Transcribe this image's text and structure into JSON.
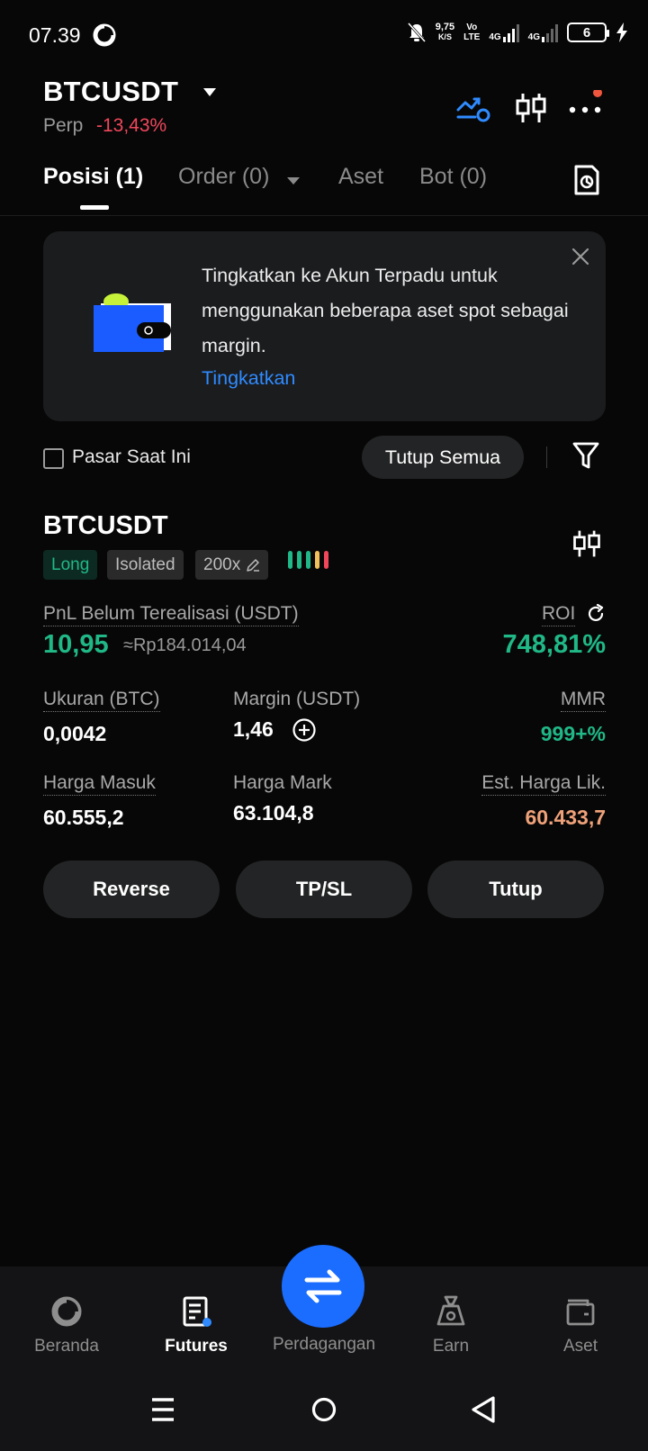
{
  "status_bar": {
    "time": "07.39",
    "speed_value": "9,75",
    "speed_unit": "K/S",
    "volte_top": "Vo",
    "volte_bottom": "LTE",
    "sim1": "4G",
    "sim2": "4G",
    "battery": "6"
  },
  "header": {
    "pair": "BTCUSDT",
    "contract_type": "Perp",
    "change": "-13,43%",
    "icons": [
      "trade-signal-icon",
      "candlestick-icon",
      "more-icon"
    ]
  },
  "tabs": [
    {
      "label": "Posisi (1)",
      "active": true
    },
    {
      "label": "Order (0)",
      "active": false,
      "has_dropdown": true
    },
    {
      "label": "Aset",
      "active": false
    },
    {
      "label": "Bot (0)",
      "active": false
    }
  ],
  "banner": {
    "text": "Tingkatkan ke Akun Terpadu untuk menggunakan beberapa aset spot sebagai margin.",
    "link": "Tingkatkan"
  },
  "filter": {
    "checkbox_label": "Pasar Saat Ini",
    "checked": false,
    "close_all": "Tutup Semua"
  },
  "position": {
    "symbol": "BTCUSDT",
    "side": "Long",
    "margin_mode": "Isolated",
    "leverage": "200x",
    "pnl_label": "PnL Belum Terealisasi (USDT)",
    "pnl_value": "10,95",
    "pnl_idr": "≈Rp184.014,04",
    "roi_label": "ROI",
    "roi_value": "748,81%",
    "size_label": "Ukuran (BTC)",
    "size_value": "0,0042",
    "margin_label": "Margin (USDT)",
    "margin_value": "1,46",
    "mmr_label": "MMR",
    "mmr_value": "999+%",
    "entry_label": "Harga Masuk",
    "entry_value": "60.555,2",
    "mark_label": "Harga Mark",
    "mark_value": "63.104,8",
    "liq_label": "Est. Harga Lik.",
    "liq_value": "60.433,7",
    "buttons": [
      "Reverse",
      "TP/SL",
      "Tutup"
    ]
  },
  "colors": {
    "accent_blue": "#1a6dff",
    "profit_green": "#20b887",
    "loss_red": "#f0475c",
    "liq_orange": "#f0a27a"
  },
  "bottom_nav": {
    "items": [
      {
        "label": "Beranda",
        "icon": "home-icon",
        "active": false
      },
      {
        "label": "Futures",
        "icon": "futures-icon",
        "active": true
      },
      {
        "label": "Perdagangan",
        "icon": "swap-icon",
        "active": false
      },
      {
        "label": "Earn",
        "icon": "earn-icon",
        "active": false
      },
      {
        "label": "Aset",
        "icon": "wallet-icon",
        "active": false
      }
    ]
  }
}
